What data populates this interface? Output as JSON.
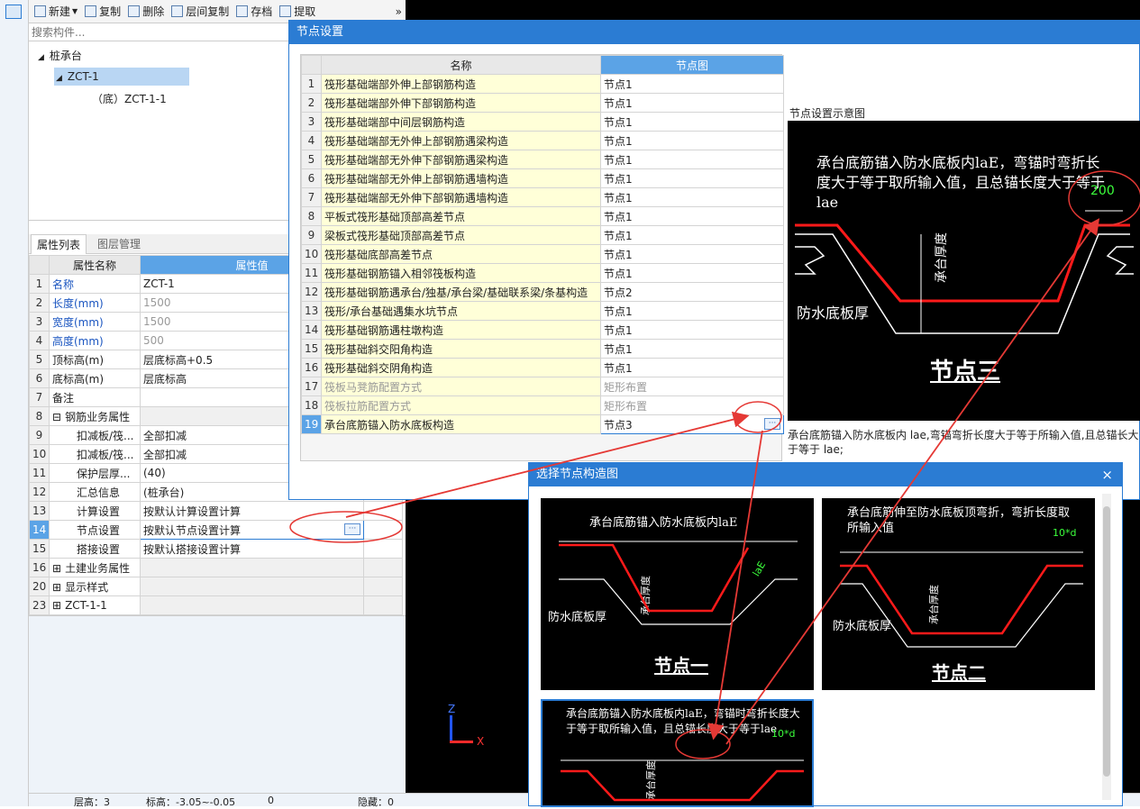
{
  "toolbar": {
    "new": "新建",
    "copy": "复制",
    "delete": "删除",
    "floor_copy": "层间复制",
    "save": "存档",
    "extract": "提取",
    "more": "»"
  },
  "search": {
    "placeholder": "搜索构件..."
  },
  "tree": {
    "root": "桩承台",
    "child": "ZCT-1",
    "grandchild": "（底）ZCT-1-1"
  },
  "prop_tabs": {
    "tab1": "属性列表",
    "tab2": "图层管理"
  },
  "prop_table": {
    "col_name": "属性名称",
    "col_value": "属性值",
    "rows": [
      {
        "n": "1",
        "name": "名称",
        "value": "ZCT-1"
      },
      {
        "n": "2",
        "name": "长度(mm)",
        "value": "1500"
      },
      {
        "n": "3",
        "name": "宽度(mm)",
        "value": "1500"
      },
      {
        "n": "4",
        "name": "高度(mm)",
        "value": "500"
      },
      {
        "n": "5",
        "name": "顶标高(m)",
        "value": "层底标高+0.5"
      },
      {
        "n": "6",
        "name": "底标高(m)",
        "value": "层底标高"
      },
      {
        "n": "7",
        "name": "备注",
        "value": ""
      },
      {
        "n": "8",
        "name": "钢筋业务属性",
        "value": ""
      },
      {
        "n": "9",
        "name": "扣减板/筏...",
        "value": "全部扣减"
      },
      {
        "n": "10",
        "name": "扣减板/筏...",
        "value": "全部扣减"
      },
      {
        "n": "11",
        "name": "保护层厚...",
        "value": "(40)"
      },
      {
        "n": "12",
        "name": "汇总信息",
        "value": "(桩承台)"
      },
      {
        "n": "13",
        "name": "计算设置",
        "value": "按默认计算设置计算"
      },
      {
        "n": "14",
        "name": "节点设置",
        "value": "按默认节点设置计算"
      },
      {
        "n": "15",
        "name": "搭接设置",
        "value": "按默认搭接设置计算"
      },
      {
        "n": "16",
        "name": "土建业务属性",
        "value": ""
      },
      {
        "n": "20",
        "name": "显示样式",
        "value": ""
      },
      {
        "n": "23",
        "name": "ZCT-1-1",
        "value": ""
      }
    ]
  },
  "node_dialog": {
    "title": "节点设置",
    "col_name": "名称",
    "col_node": "节点图",
    "rows": [
      {
        "n": "1",
        "name": "筏形基础端部外伸上部钢筋构造",
        "node": "节点1"
      },
      {
        "n": "2",
        "name": "筏形基础端部外伸下部钢筋构造",
        "node": "节点1"
      },
      {
        "n": "3",
        "name": "筏形基础端部中间层钢筋构造",
        "node": "节点1"
      },
      {
        "n": "4",
        "name": "筏形基础端部无外伸上部钢筋遇梁构造",
        "node": "节点1"
      },
      {
        "n": "5",
        "name": "筏形基础端部无外伸下部钢筋遇梁构造",
        "node": "节点1"
      },
      {
        "n": "6",
        "name": "筏形基础端部无外伸上部钢筋遇墙构造",
        "node": "节点1"
      },
      {
        "n": "7",
        "name": "筏形基础端部无外伸下部钢筋遇墙构造",
        "node": "节点1"
      },
      {
        "n": "8",
        "name": "平板式筏形基础顶部高差节点",
        "node": "节点1"
      },
      {
        "n": "9",
        "name": "梁板式筏形基础顶部高差节点",
        "node": "节点1"
      },
      {
        "n": "10",
        "name": "筏形基础底部高差节点",
        "node": "节点1"
      },
      {
        "n": "11",
        "name": "筏形基础钢筋锚入相邻筏板构造",
        "node": "节点1"
      },
      {
        "n": "12",
        "name": "筏形基础钢筋遇承台/独基/承台梁/基础联系梁/条基构造",
        "node": "节点2"
      },
      {
        "n": "13",
        "name": "筏形/承台基础遇集水坑节点",
        "node": "节点1"
      },
      {
        "n": "14",
        "name": "筏形基础钢筋遇柱墩构造",
        "node": "节点1"
      },
      {
        "n": "15",
        "name": "筏形基础斜交阳角构造",
        "node": "节点1"
      },
      {
        "n": "16",
        "name": "筏形基础斜交阴角构造",
        "node": "节点1"
      },
      {
        "n": "17",
        "name": "筏板马凳筋配置方式",
        "node": "矩形布置"
      },
      {
        "n": "18",
        "name": "筏板拉筋配置方式",
        "node": "矩形布置"
      },
      {
        "n": "19",
        "name": "承台底筋锚入防水底板构造",
        "node": "节点3"
      }
    ],
    "preview_title": "节点设置示意图",
    "preview_text": "承台底筋锚入防水底板内laE，弯锚时弯折长度大于等于取所输入值，且总锚长度大于等于lae",
    "preview_value": "200",
    "preview_label_side": "防水底板厚",
    "preview_label_mid": "承台厚度",
    "preview_caption": "节点三",
    "description": "承台底筋锚入防水底板内 lae,弯锚弯折长度大于等于所输入值,且总锚长大于等于 lae;"
  },
  "select_dialog": {
    "title": "选择节点构造图",
    "close": "×",
    "opt1": {
      "text": "承台底筋锚入防水底板内laE",
      "value": "laE",
      "side": "防水底板厚",
      "mid": "承台厚度",
      "caption": "节点一"
    },
    "opt2": {
      "text": "承台底筋伸至防水底板顶弯折，弯折长度取所输入值",
      "value": "10*d",
      "side": "防水底板厚",
      "mid": "承台厚度",
      "caption": "节点二"
    },
    "opt3": {
      "text": "承台底筋锚入防水底板内laE，弯锚时弯折长度大于等于取所输入值，且总锚长度大于等于lae",
      "value": "10*d",
      "mid": "承台厚度"
    }
  },
  "axes": {
    "z": "Z",
    "x": "X"
  },
  "status": {
    "a": "层高：3",
    "b": "标高：-3.05~-0.05",
    "c": "0",
    "d": "隐藏：0"
  },
  "colors": {
    "accent": "#2b7cd3",
    "header_blue": "#5ba3e6",
    "annotation": "#e53935",
    "rebar": "#ff1a1a"
  }
}
